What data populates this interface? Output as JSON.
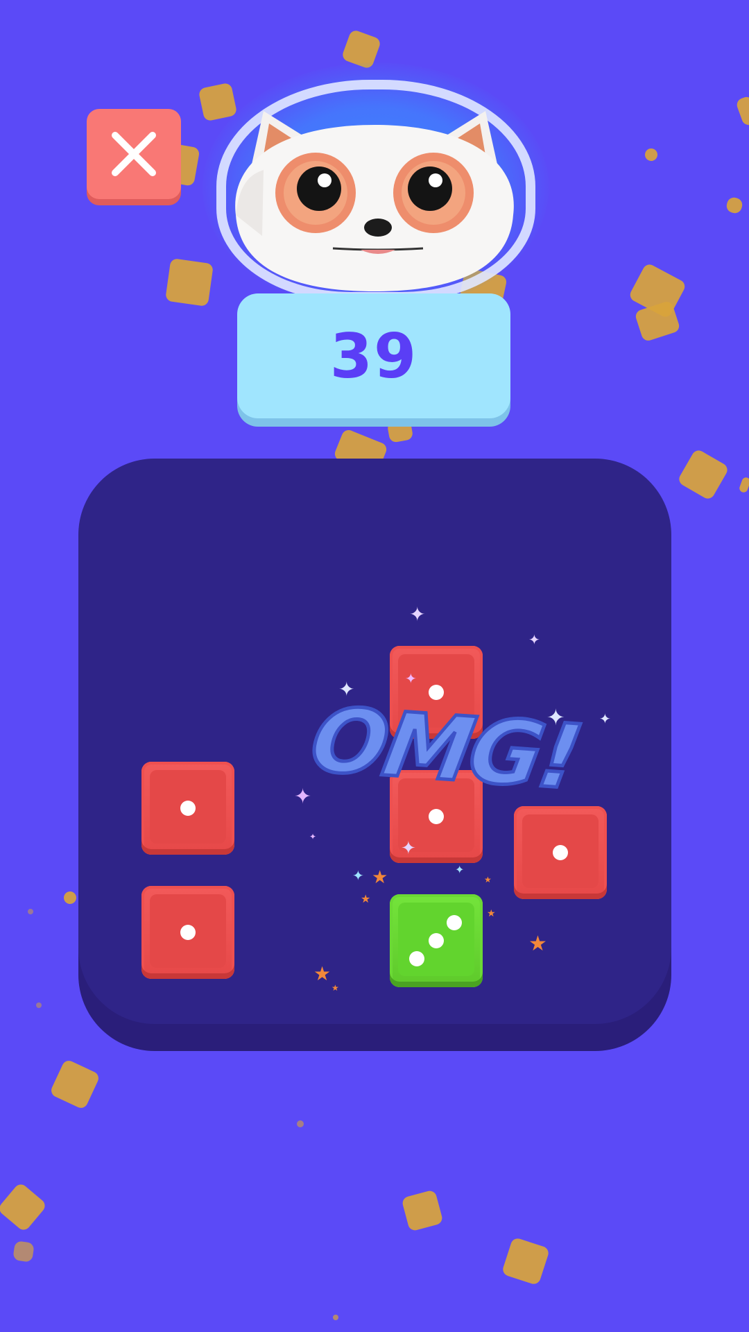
{
  "game": {
    "score": "39",
    "banner_text": "OMG!",
    "close_icon": "close-icon",
    "mascot": "cat-mascot-icon"
  },
  "board": {
    "dice": [
      {
        "color": "red",
        "value": 1
      },
      {
        "color": "red",
        "value": 1
      },
      {
        "color": "red",
        "value": 1
      },
      {
        "color": "red",
        "value": 1
      },
      {
        "color": "red",
        "value": 1
      },
      {
        "color": "green",
        "value": 3
      }
    ]
  },
  "colors": {
    "background": "#5b4af7",
    "board": "#2f2488",
    "score_plate": "#a0e5fe",
    "score_text": "#5a3ef6",
    "close_button": "#f97875",
    "die_red": "#e64848",
    "die_green": "#62d42e"
  }
}
